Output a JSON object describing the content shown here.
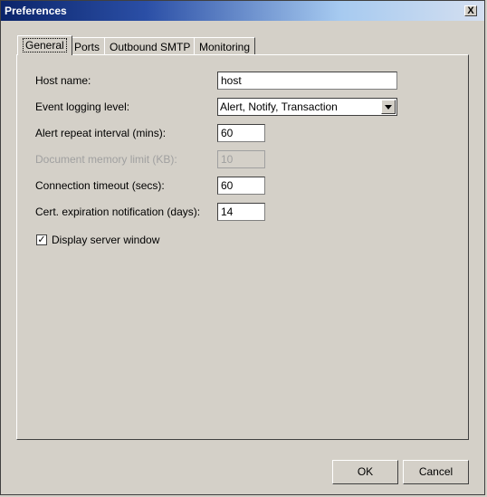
{
  "window": {
    "title": "Preferences",
    "close_label": "X"
  },
  "tabs": [
    {
      "label": "General",
      "active": true
    },
    {
      "label": "Ports"
    },
    {
      "label": "Outbound SMTP"
    },
    {
      "label": "Monitoring"
    }
  ],
  "general": {
    "host_name": {
      "label": "Host name:",
      "value": "host"
    },
    "event_logging": {
      "label": "Event logging level:",
      "value": "Alert, Notify, Transaction"
    },
    "alert_repeat": {
      "label": "Alert repeat interval (mins):",
      "value": "60"
    },
    "doc_memory": {
      "label": "Document memory limit (KB):",
      "value": "10",
      "disabled": true
    },
    "conn_timeout": {
      "label": "Connection timeout (secs):",
      "value": "60"
    },
    "cert_expiration": {
      "label": "Cert. expiration notification (days):",
      "value": "14"
    },
    "display_server": {
      "label": "Display server window",
      "checked": true,
      "mark": "✓"
    }
  },
  "buttons": {
    "ok": "OK",
    "cancel": "Cancel"
  }
}
